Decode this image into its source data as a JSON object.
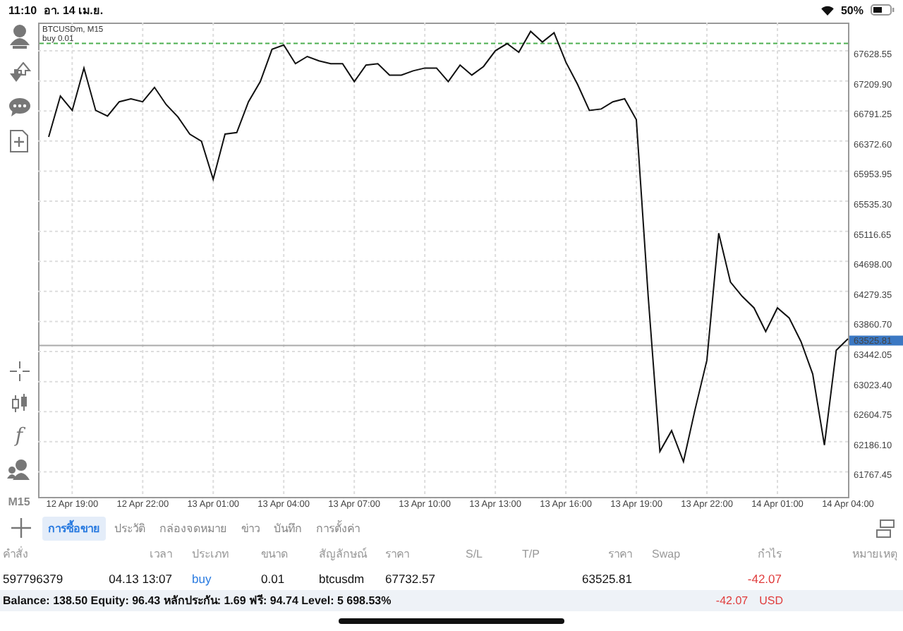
{
  "status_bar": {
    "time": "11:10",
    "date": "อา. 14 เม.ย.",
    "battery": "50%"
  },
  "toolbar": {
    "top": [
      {
        "kind": "person"
      },
      {
        "kind": "arrows"
      },
      {
        "kind": "chat"
      },
      {
        "kind": "add-doc"
      }
    ],
    "bottom": [
      {
        "kind": "crosshair"
      },
      {
        "kind": "candles"
      },
      {
        "kind": "function",
        "glyph": "f"
      },
      {
        "kind": "people"
      }
    ],
    "timeframe": "M15"
  },
  "chart": {
    "chart_data": {
      "type": "line",
      "title": "BTCUSDm, M15",
      "categories": [
        null,
        null,
        "12 Apr 19:00",
        null,
        null,
        null,
        null,
        null,
        "12 Apr 22:00",
        null,
        null,
        null,
        null,
        null,
        "13 Apr 01:00",
        null,
        null,
        null,
        null,
        null,
        "13 Apr 04:00",
        null,
        null,
        null,
        null,
        null,
        "13 Apr 07:00",
        null,
        null,
        null,
        null,
        null,
        "13 Apr 10:00",
        null,
        null,
        null,
        null,
        null,
        "13 Apr 13:00",
        null,
        null,
        null,
        null,
        null,
        "13 Apr 16:00",
        null,
        null,
        null,
        null,
        null,
        "13 Apr 19:00",
        null,
        null,
        null,
        null,
        null,
        "13 Apr 22:00",
        null,
        null,
        null,
        null,
        null,
        "14 Apr 01:00",
        null,
        null,
        null,
        null,
        null,
        "14 Apr 04:00"
      ],
      "series": [
        {
          "color": "#111111",
          "values": [
            66430,
            67000,
            66800,
            67390,
            66800,
            66720,
            66920,
            66960,
            66920,
            67120,
            66880,
            66710,
            66470,
            66370,
            65840,
            66470,
            66490,
            66920,
            67200,
            67650,
            67710,
            67450,
            67550,
            67490,
            67450,
            67450,
            67200,
            67430,
            67450,
            67290,
            67290,
            67350,
            67390,
            67390,
            67200,
            67430,
            67290,
            67410,
            67630,
            67730,
            67610,
            67900,
            67750,
            67880,
            67470,
            67160,
            66800,
            66820,
            66920,
            66960,
            66670,
            64210,
            62050,
            62340,
            61910,
            62640,
            63320,
            65090,
            64410,
            64210,
            64050,
            63720,
            64050,
            63910,
            63580,
            63130,
            62140,
            63460,
            63620
          ]
        }
      ],
      "ylim": [
        61418,
        68022
      ],
      "grid": true,
      "yticks": [
        {
          "value": 67628.55,
          "label": "67628.55"
        },
        {
          "value": 67209.9,
          "label": "67209.90"
        },
        {
          "value": 66791.25,
          "label": "66791.25"
        },
        {
          "value": 66372.6,
          "label": "66372.60"
        },
        {
          "value": 65953.95,
          "label": "65953.95"
        },
        {
          "value": 65535.3,
          "label": "65535.30"
        },
        {
          "value": 65116.65,
          "label": "65116.65"
        },
        {
          "value": 64698,
          "label": "64698.00"
        },
        {
          "value": 64279.35,
          "label": "64279.35"
        },
        {
          "value": 63860.7,
          "label": "63860.70"
        },
        {
          "value": 63442.05,
          "label": "63442.05"
        },
        {
          "value": 63023.4,
          "label": "63023.40"
        },
        {
          "value": 62604.75,
          "label": "62604.75"
        },
        {
          "value": 62186.1,
          "label": "62186.10"
        },
        {
          "value": 61767.45,
          "label": "61767.45"
        }
      ],
      "ref_lines": [
        {
          "axis": "y",
          "value": 67732.57,
          "label": "buy 0.01"
        },
        {
          "axis": "y",
          "value": 63525.81,
          "label": "63525.81"
        }
      ]
    }
  },
  "tabs": [
    {
      "label": "การซื้อขาย",
      "selected": true
    },
    {
      "label": "ประวัติ",
      "selected": false
    },
    {
      "label": "กล่องจดหมาย",
      "selected": false
    },
    {
      "label": "ข่าว",
      "selected": false
    },
    {
      "label": "บันทึก",
      "selected": false
    },
    {
      "label": "การตั้งค่า",
      "selected": false
    }
  ],
  "table": {
    "columns": [
      "คำสั่ง",
      "เวลา",
      "ประเภท",
      "ขนาด",
      "สัญลักษณ์",
      "ราคา",
      "S/L",
      "T/P",
      "ราคา",
      "Swap",
      "กำไร",
      "หมายเหตุ"
    ],
    "rows": [
      {
        "cells": [
          "597796379",
          "04.13 13:07",
          "buy",
          "0.01",
          "btcusdm",
          "67732.57",
          "",
          "",
          "63525.81",
          "",
          "-42.07",
          ""
        ]
      }
    ]
  },
  "summary": {
    "text": "Balance: 138.50 Equity: 96.43 หลักประกัน: 1.69 ฟรี: 94.74 Level: 5 698.53%",
    "profit": "-42.07",
    "currency": "USD"
  }
}
